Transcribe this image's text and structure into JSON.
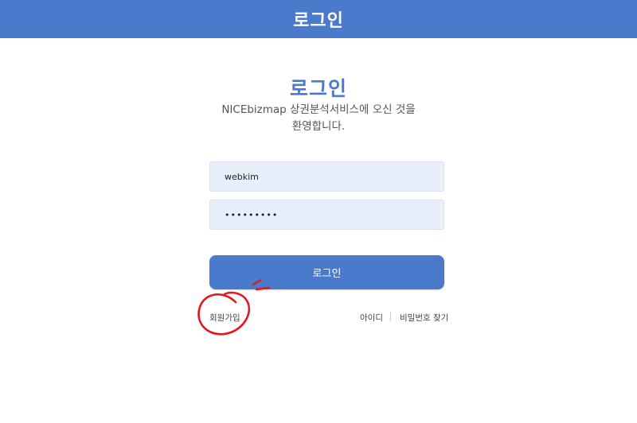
{
  "header": {
    "title": "로그인"
  },
  "main": {
    "heading": "로그인",
    "welcome_line1": "NICEbizmap 상권분석서비스에 오신 것을",
    "welcome_line2": "환영합니다."
  },
  "form": {
    "user_id": "webkim",
    "password": "•••••••••",
    "submit_label": "로그인"
  },
  "links": {
    "signup": "회원가입",
    "find_id": "아이디",
    "find_password": "비밀번호 찾기"
  },
  "colors": {
    "accent": "#4a7acc",
    "input_bg": "#e9effa",
    "annotation": "#e8141e"
  }
}
